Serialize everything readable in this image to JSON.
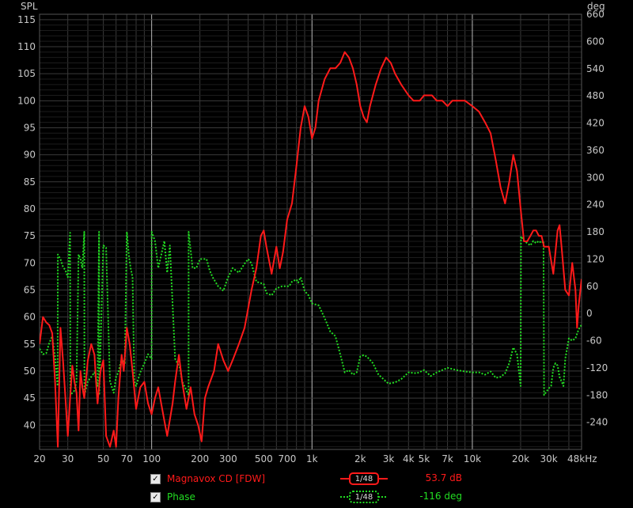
{
  "chart_data": {
    "type": "line",
    "title": "",
    "xlabel": "",
    "ylabel_left": "SPL",
    "ylabel_right": "deg",
    "x_scale": "log",
    "xlim": [
      20,
      48000
    ],
    "ylim_left": [
      35.5,
      116
    ],
    "ylim_right": [
      -300,
      660
    ],
    "grid": true,
    "x_ticks": [
      {
        "v": 20,
        "t": "20"
      },
      {
        "v": 30,
        "t": "30"
      },
      {
        "v": 50,
        "t": "50"
      },
      {
        "v": 70,
        "t": "70"
      },
      {
        "v": 100,
        "t": "100"
      },
      {
        "v": 200,
        "t": "200"
      },
      {
        "v": 300,
        "t": "300"
      },
      {
        "v": 500,
        "t": "500"
      },
      {
        "v": 700,
        "t": "700"
      },
      {
        "v": 1000,
        "t": "1k"
      },
      {
        "v": 2000,
        "t": "2k"
      },
      {
        "v": 3000,
        "t": "3k"
      },
      {
        "v": 4000,
        "t": "4k"
      },
      {
        "v": 5000,
        "t": "5k"
      },
      {
        "v": 7000,
        "t": "7k"
      },
      {
        "v": 10000,
        "t": "10k"
      },
      {
        "v": 20000,
        "t": "20k"
      },
      {
        "v": 30000,
        "t": "30k"
      },
      {
        "v": 48000,
        "t": "48kHz"
      }
    ],
    "y_left_ticks": [
      40,
      45,
      50,
      55,
      60,
      65,
      70,
      75,
      80,
      85,
      90,
      95,
      100,
      105,
      110,
      115
    ],
    "y_right_ticks": [
      -240,
      -180,
      -120,
      -60,
      0,
      60,
      120,
      180,
      240,
      300,
      360,
      420,
      480,
      540,
      600,
      660
    ],
    "series": [
      {
        "name": "Magnavox CD [FDW]",
        "axis": "left",
        "color": "#ff1a1a",
        "style": "solid",
        "points": [
          [
            20,
            55
          ],
          [
            21,
            60
          ],
          [
            22,
            59
          ],
          [
            23,
            58.5
          ],
          [
            24,
            57
          ],
          [
            25,
            48
          ],
          [
            26,
            36
          ],
          [
            27,
            58
          ],
          [
            28,
            52
          ],
          [
            29,
            45
          ],
          [
            30,
            38
          ],
          [
            31,
            45
          ],
          [
            32,
            51
          ],
          [
            33,
            48
          ],
          [
            34,
            46
          ],
          [
            35,
            39
          ],
          [
            36,
            50
          ],
          [
            37,
            47
          ],
          [
            38,
            45
          ],
          [
            40,
            52
          ],
          [
            42,
            55
          ],
          [
            44,
            53
          ],
          [
            45,
            48
          ],
          [
            46,
            44
          ],
          [
            48,
            50
          ],
          [
            50,
            52
          ],
          [
            52,
            38
          ],
          [
            55,
            36
          ],
          [
            58,
            39
          ],
          [
            60,
            36
          ],
          [
            62,
            45
          ],
          [
            65,
            53
          ],
          [
            67,
            50
          ],
          [
            70,
            58
          ],
          [
            73,
            55
          ],
          [
            76,
            50
          ],
          [
            80,
            43
          ],
          [
            85,
            47
          ],
          [
            90,
            48
          ],
          [
            95,
            44
          ],
          [
            100,
            42
          ],
          [
            105,
            45
          ],
          [
            110,
            47
          ],
          [
            118,
            42
          ],
          [
            125,
            38
          ],
          [
            135,
            44
          ],
          [
            140,
            48
          ],
          [
            148,
            53
          ],
          [
            155,
            48
          ],
          [
            165,
            43
          ],
          [
            175,
            47
          ],
          [
            185,
            42
          ],
          [
            195,
            40
          ],
          [
            205,
            37
          ],
          [
            215,
            45
          ],
          [
            225,
            47
          ],
          [
            245,
            50
          ],
          [
            260,
            55
          ],
          [
            280,
            52
          ],
          [
            300,
            50
          ],
          [
            320,
            52
          ],
          [
            350,
            55
          ],
          [
            380,
            58
          ],
          [
            420,
            65
          ],
          [
            450,
            69
          ],
          [
            480,
            75
          ],
          [
            500,
            76
          ],
          [
            520,
            73
          ],
          [
            560,
            68
          ],
          [
            600,
            73
          ],
          [
            630,
            69
          ],
          [
            660,
            72
          ],
          [
            700,
            78
          ],
          [
            750,
            81
          ],
          [
            800,
            88
          ],
          [
            850,
            95
          ],
          [
            900,
            99
          ],
          [
            950,
            97
          ],
          [
            1000,
            93
          ],
          [
            1050,
            95
          ],
          [
            1100,
            100
          ],
          [
            1200,
            104
          ],
          [
            1300,
            106
          ],
          [
            1400,
            106
          ],
          [
            1500,
            107
          ],
          [
            1600,
            109
          ],
          [
            1700,
            108
          ],
          [
            1800,
            106
          ],
          [
            1900,
            103
          ],
          [
            2000,
            99
          ],
          [
            2100,
            97
          ],
          [
            2200,
            96
          ],
          [
            2300,
            99
          ],
          [
            2500,
            103
          ],
          [
            2700,
            106
          ],
          [
            2900,
            108
          ],
          [
            3100,
            107
          ],
          [
            3300,
            105
          ],
          [
            3600,
            103
          ],
          [
            4000,
            101
          ],
          [
            4300,
            100
          ],
          [
            4700,
            100
          ],
          [
            5000,
            101
          ],
          [
            5300,
            101
          ],
          [
            5600,
            101
          ],
          [
            6000,
            100
          ],
          [
            6500,
            100
          ],
          [
            7000,
            99
          ],
          [
            7500,
            100
          ],
          [
            8000,
            100
          ],
          [
            8500,
            100
          ],
          [
            9000,
            100
          ],
          [
            10000,
            99
          ],
          [
            11000,
            98
          ],
          [
            12000,
            96
          ],
          [
            13000,
            94
          ],
          [
            14000,
            89
          ],
          [
            15000,
            84
          ],
          [
            16000,
            81
          ],
          [
            17000,
            85
          ],
          [
            18000,
            90
          ],
          [
            19000,
            87
          ],
          [
            20000,
            80
          ],
          [
            21000,
            74
          ],
          [
            22000,
            74
          ],
          [
            23000,
            75
          ],
          [
            24000,
            76
          ],
          [
            25000,
            76
          ],
          [
            26000,
            75
          ],
          [
            27000,
            75
          ],
          [
            28000,
            73
          ],
          [
            30000,
            73
          ],
          [
            32000,
            68
          ],
          [
            33000,
            72
          ],
          [
            34000,
            76
          ],
          [
            35000,
            77
          ],
          [
            36000,
            73
          ],
          [
            38000,
            65
          ],
          [
            40000,
            64
          ],
          [
            42000,
            70
          ],
          [
            44000,
            65
          ],
          [
            45000,
            58
          ],
          [
            46000,
            62
          ],
          [
            48000,
            67
          ]
        ]
      },
      {
        "name": "Phase",
        "axis": "right",
        "color": "#22dd22",
        "style": "dotted",
        "points": [
          [
            20,
            -78
          ],
          [
            21,
            -90
          ],
          [
            22,
            -88
          ],
          [
            23,
            -65
          ],
          [
            24,
            -50
          ],
          [
            25,
            -96
          ],
          [
            25.9,
            -160
          ],
          [
            26,
            130
          ],
          [
            27,
            120
          ],
          [
            28,
            103
          ],
          [
            29,
            95
          ],
          [
            30,
            80
          ],
          [
            31,
            178
          ],
          [
            31.1,
            -180
          ],
          [
            33,
            -170
          ],
          [
            34,
            -150
          ],
          [
            35,
            130
          ],
          [
            36,
            120
          ],
          [
            37,
            100
          ],
          [
            38,
            180
          ],
          [
            38.1,
            -180
          ],
          [
            40,
            -150
          ],
          [
            42,
            -140
          ],
          [
            44,
            -130
          ],
          [
            46,
            -160
          ],
          [
            47,
            180
          ],
          [
            47.1,
            -180
          ],
          [
            50,
            150
          ],
          [
            52,
            145
          ],
          [
            55,
            -150
          ],
          [
            58,
            -175
          ],
          [
            60,
            -140
          ],
          [
            62,
            -130
          ],
          [
            65,
            -100
          ],
          [
            68,
            -110
          ],
          [
            70,
            180
          ],
          [
            72,
            130
          ],
          [
            74,
            100
          ],
          [
            76,
            80
          ],
          [
            78,
            -150
          ],
          [
            80,
            -160
          ],
          [
            85,
            -130
          ],
          [
            90,
            -110
          ],
          [
            95,
            -90
          ],
          [
            100,
            -100
          ],
          [
            100.1,
            180
          ],
          [
            105,
            160
          ],
          [
            110,
            100
          ],
          [
            115,
            130
          ],
          [
            120,
            160
          ],
          [
            125,
            90
          ],
          [
            130,
            150
          ],
          [
            140,
            -100
          ],
          [
            150,
            -120
          ],
          [
            155,
            -150
          ],
          [
            160,
            -160
          ],
          [
            170,
            -180
          ],
          [
            170.1,
            180
          ],
          [
            175,
            140
          ],
          [
            180,
            100
          ],
          [
            190,
            100
          ],
          [
            200,
            120
          ],
          [
            220,
            120
          ],
          [
            230,
            95
          ],
          [
            240,
            80
          ],
          [
            260,
            60
          ],
          [
            280,
            50
          ],
          [
            300,
            80
          ],
          [
            320,
            100
          ],
          [
            350,
            90
          ],
          [
            380,
            110
          ],
          [
            400,
            120
          ],
          [
            420,
            110
          ],
          [
            450,
            70
          ],
          [
            500,
            65
          ],
          [
            520,
            45
          ],
          [
            560,
            40
          ],
          [
            600,
            55
          ],
          [
            650,
            60
          ],
          [
            700,
            60
          ],
          [
            720,
            60
          ],
          [
            750,
            70
          ],
          [
            800,
            75
          ],
          [
            820,
            68
          ],
          [
            850,
            80
          ],
          [
            900,
            50
          ],
          [
            950,
            40
          ],
          [
            1000,
            22
          ],
          [
            1050,
            20
          ],
          [
            1100,
            18
          ],
          [
            1200,
            -10
          ],
          [
            1300,
            -40
          ],
          [
            1400,
            -50
          ],
          [
            1500,
            -90
          ],
          [
            1600,
            -130
          ],
          [
            1700,
            -125
          ],
          [
            1800,
            -135
          ],
          [
            1900,
            -130
          ],
          [
            2000,
            -95
          ],
          [
            2100,
            -92
          ],
          [
            2200,
            -95
          ],
          [
            2400,
            -110
          ],
          [
            2600,
            -135
          ],
          [
            3000,
            -155
          ],
          [
            3300,
            -152
          ],
          [
            3600,
            -145
          ],
          [
            4000,
            -130
          ],
          [
            4500,
            -132
          ],
          [
            5000,
            -125
          ],
          [
            5500,
            -138
          ],
          [
            6000,
            -130
          ],
          [
            7000,
            -120
          ],
          [
            8000,
            -125
          ],
          [
            9000,
            -128
          ],
          [
            10000,
            -130
          ],
          [
            11000,
            -130
          ],
          [
            12000,
            -135
          ],
          [
            13000,
            -128
          ],
          [
            14000,
            -142
          ],
          [
            15000,
            -140
          ],
          [
            16000,
            -132
          ],
          [
            17000,
            -110
          ],
          [
            18000,
            -75
          ],
          [
            19000,
            -90
          ],
          [
            20000,
            -160
          ],
          [
            20100,
            170
          ],
          [
            21000,
            160
          ],
          [
            22000,
            155
          ],
          [
            23000,
            150
          ],
          [
            24000,
            160
          ],
          [
            25000,
            155
          ],
          [
            26000,
            160
          ],
          [
            27000,
            155
          ],
          [
            27800,
            160
          ],
          [
            28000,
            -180
          ],
          [
            30000,
            -165
          ],
          [
            31000,
            -160
          ],
          [
            32000,
            -120
          ],
          [
            33000,
            -110
          ],
          [
            34000,
            -115
          ],
          [
            35000,
            -140
          ],
          [
            36000,
            -150
          ],
          [
            37000,
            -160
          ],
          [
            38000,
            -100
          ],
          [
            40000,
            -55
          ],
          [
            42000,
            -60
          ],
          [
            44000,
            -55
          ],
          [
            46000,
            -35
          ],
          [
            48000,
            -25
          ]
        ]
      }
    ],
    "legend": {
      "entries": [
        {
          "label": "Magnavox CD [FDW]",
          "smoothing": "1/48",
          "readout": "53.7 dB",
          "color": "#ff1a1a"
        },
        {
          "label": "Phase",
          "smoothing": "1/48",
          "readout": "-116 deg",
          "color": "#22dd22"
        }
      ]
    }
  }
}
